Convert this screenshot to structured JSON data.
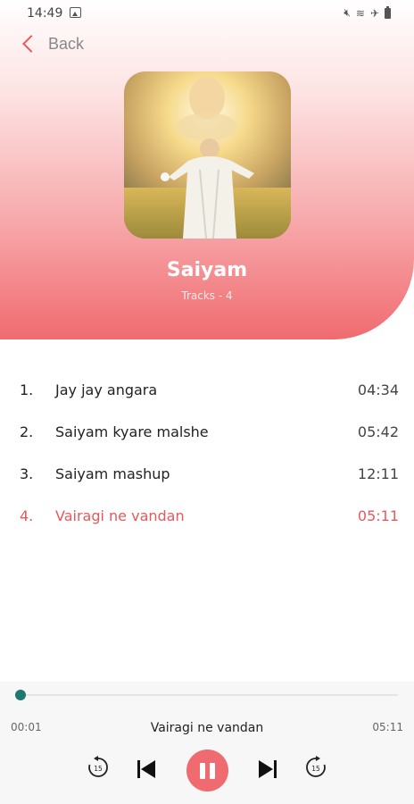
{
  "status_bar": {
    "time": "14:49",
    "icons": [
      "image-icon",
      "mute-icon",
      "wifi-icon",
      "airplane-icon",
      "battery-icon"
    ]
  },
  "header": {
    "back_label": "Back"
  },
  "album": {
    "title": "Saiyam",
    "tracks_label": "Tracks - 4"
  },
  "tracks": [
    {
      "number": "1.",
      "name": "Jay jay angara",
      "duration": "04:34",
      "active": false
    },
    {
      "number": "2.",
      "name": "Saiyam kyare malshe",
      "duration": "05:42",
      "active": false
    },
    {
      "number": "3.",
      "name": "Saiyam mashup",
      "duration": "12:11",
      "active": false
    },
    {
      "number": "4.",
      "name": "Vairagi ne vandan",
      "duration": "05:11",
      "active": true
    }
  ],
  "player": {
    "now_playing": "Vairagi ne vandan",
    "elapsed": "00:01",
    "total": "05:11",
    "progress": 0.003,
    "skip_seconds": "15"
  },
  "colors": {
    "accent": "#e8585c",
    "play_button": "#f06b70",
    "progress": "#1c7a6e"
  }
}
